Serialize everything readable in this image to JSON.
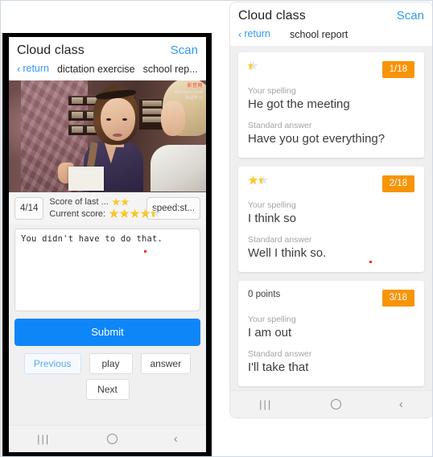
{
  "app": {
    "title": "Cloud class",
    "scan_label": "Scan",
    "return_label": "return",
    "chevron_icon": "chevron-left-icon"
  },
  "left_phone": {
    "breadcrumbs": [
      "dictation exercise",
      "school rep..."
    ],
    "video": {
      "watermark_line1": "影音网",
      "watermark_line2": "wfxiaotu.com",
      "watermark_line3": "英语学习"
    },
    "score_bar": {
      "progress": "4/14",
      "last_score_label": "Score of last ...",
      "last_score_stars": 2,
      "current_score_label": "Current score:",
      "current_score_stars": 4.5,
      "speed_label": "speed:st..."
    },
    "answer_input": {
      "value": "You didn't have to do that.",
      "placeholder": ""
    },
    "buttons": {
      "submit": "Submit",
      "previous": "Previous",
      "play": "play",
      "answer": "answer",
      "next": "Next"
    }
  },
  "right_phone": {
    "breadcrumb": "school report",
    "labels": {
      "your_spelling": "Your spelling",
      "standard_answer": "Standard answer"
    },
    "cards": [
      {
        "stars": 0.5,
        "score_text": null,
        "index": "1/18",
        "your_spelling": "He got the meeting",
        "standard_answer": "Have you got everything?"
      },
      {
        "stars": 1.5,
        "score_text": null,
        "index": "2/18",
        "your_spelling": "I think so",
        "standard_answer": "Well I think so."
      },
      {
        "stars": 0,
        "score_text": "0 points",
        "index": "3/18",
        "your_spelling": "I am out",
        "standard_answer": "I'll take that"
      }
    ]
  },
  "navbar": {
    "recents": "|||",
    "home": "",
    "back": "‹"
  },
  "colors": {
    "accent_blue": "#0e86f7",
    "link_blue": "#3398f2",
    "badge_orange": "#f89406",
    "star_gold": "#f6bb18"
  }
}
